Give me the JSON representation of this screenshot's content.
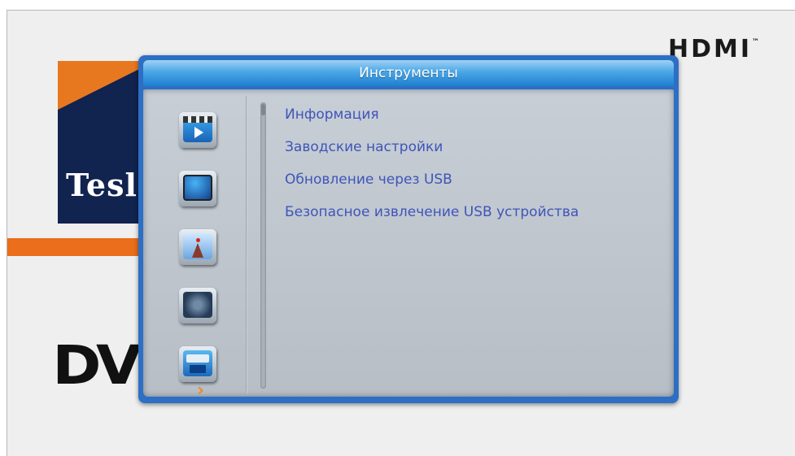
{
  "background": {
    "hdmi_logo": "HDMI",
    "banner_text": "Tesl",
    "dvb_logo": "DV"
  },
  "dialog": {
    "title": "Инструменты",
    "icons": [
      {
        "name": "media-icon"
      },
      {
        "name": "tv-icon"
      },
      {
        "name": "antenna-icon"
      },
      {
        "name": "settings-icon"
      },
      {
        "name": "tools-icon"
      }
    ],
    "selected_indicator": "›",
    "menu_items": [
      {
        "label": "Информация"
      },
      {
        "label": "Заводские настройки"
      },
      {
        "label": "Обновление через USB"
      },
      {
        "label": "Безопасное извлечение USB устройства"
      }
    ]
  },
  "colors": {
    "frame_blue": "#2c6fc5",
    "menu_text": "#3f55b8",
    "accent_orange": "#f18a1f"
  }
}
